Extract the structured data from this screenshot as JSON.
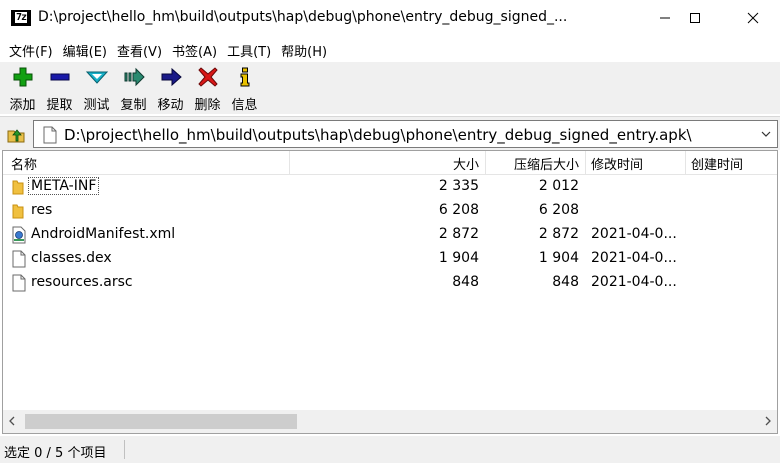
{
  "window": {
    "app_icon_text": "7z",
    "title": "D:\\project\\hello_hm\\build\\outputs\\hap\\debug\\phone\\entry_debug_signed_..."
  },
  "menu": {
    "items": [
      "文件(F)",
      "编辑(E)",
      "查看(V)",
      "书签(A)",
      "工具(T)",
      "帮助(H)"
    ]
  },
  "toolbar": {
    "buttons": [
      {
        "label": "添加",
        "icon": "plus-icon",
        "color": "#12a012"
      },
      {
        "label": "提取",
        "icon": "minus-icon",
        "color": "#1a1aa8"
      },
      {
        "label": "测试",
        "icon": "check-icon",
        "color": "#18b0c8"
      },
      {
        "label": "复制",
        "icon": "copy-arrow-icon",
        "color": "#2a8a70"
      },
      {
        "label": "移动",
        "icon": "move-arrow-icon",
        "color": "#1a1a88"
      },
      {
        "label": "删除",
        "icon": "delete-x-icon",
        "color": "#d81818"
      },
      {
        "label": "信息",
        "icon": "info-icon",
        "color": "#e8c000"
      }
    ]
  },
  "address": {
    "path": "D:\\project\\hello_hm\\build\\outputs\\hap\\debug\\phone\\entry_debug_signed_entry.apk\\"
  },
  "list": {
    "columns": [
      "名称",
      "大小",
      "压缩后大小",
      "修改时间",
      "创建时间"
    ],
    "rows": [
      {
        "name": "META-INF",
        "size": "2 335",
        "packed": "2 012",
        "modified": "",
        "type": "folder"
      },
      {
        "name": "res",
        "size": "6 208",
        "packed": "6 208",
        "modified": "",
        "type": "folder"
      },
      {
        "name": "AndroidManifest.xml",
        "size": "2 872",
        "packed": "2 872",
        "modified": "2021-04-0...",
        "type": "xml"
      },
      {
        "name": "classes.dex",
        "size": "1 904",
        "packed": "1 904",
        "modified": "2021-04-0...",
        "type": "file"
      },
      {
        "name": "resources.arsc",
        "size": "848",
        "packed": "848",
        "modified": "2021-04-0...",
        "type": "file"
      }
    ]
  },
  "status": {
    "text": "选定 0 / 5 个项目"
  }
}
